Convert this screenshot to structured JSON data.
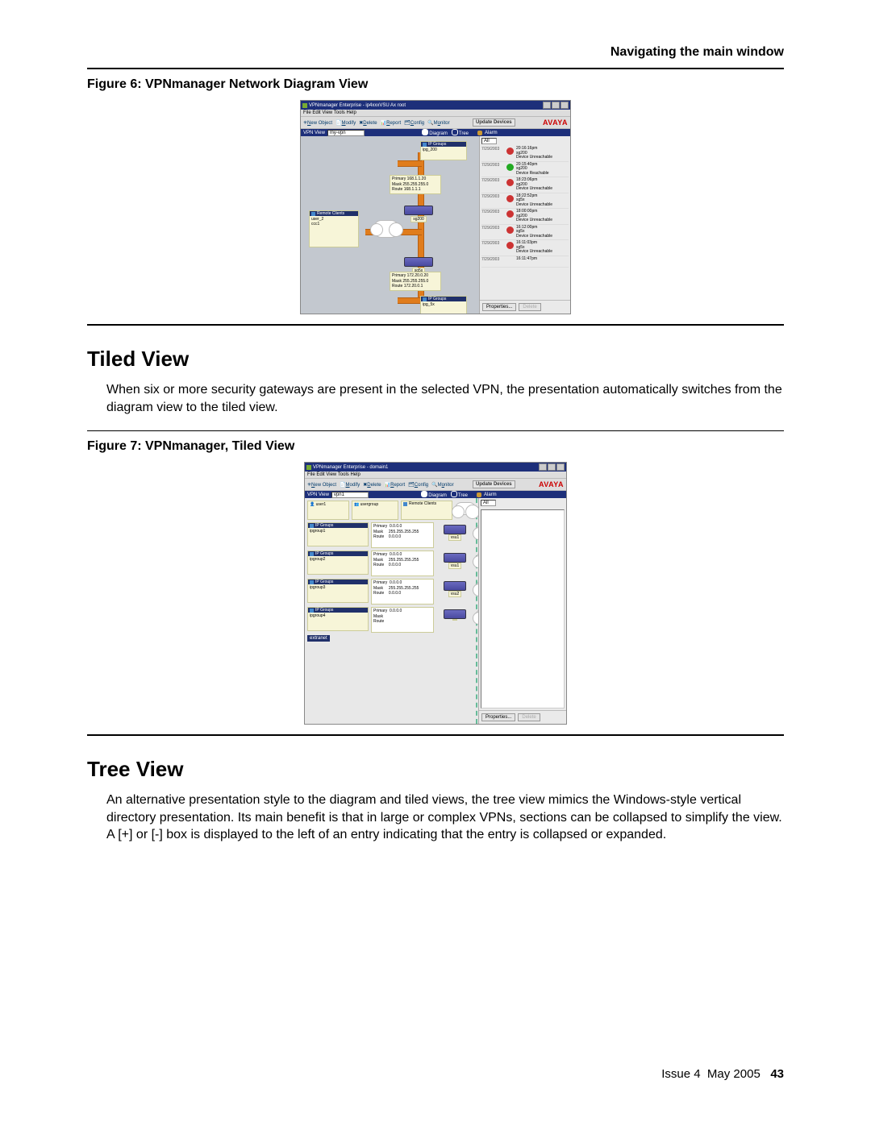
{
  "header": "Navigating the main window",
  "fig1_caption": "Figure 6: VPNmanager Network Diagram View",
  "fig2_caption": "Figure 7: VPNmanager, Tiled View",
  "tiled": {
    "heading": "Tiled View",
    "para": "When six or more security gateways are present in the selected VPN, the presentation automatically switches from the diagram view to the tiled view."
  },
  "tree": {
    "heading": "Tree View",
    "para": "An alternative presentation style to the diagram and tiled views, the tree view mimics the Windows-style vertical directory presentation. Its main benefit is that in large or complex VPNs, sections can be collapsed to simplify the view. A [+] or [-] box is displayed to the left of an entry indicating that the entry is collapsed or expanded."
  },
  "footer": {
    "issue": "Issue 4",
    "date": "May 2005",
    "page": "43"
  },
  "fig1": {
    "title": "VPNmanager Enterprise - ip4xxxVSU Ax root",
    "menu": "File  Edit  View  Tools  Help",
    "toolbar": [
      "New Object",
      "Modify",
      "Delete",
      "Report",
      "Config",
      "Monitor"
    ],
    "update": "Update Devices",
    "brand": "AVAYA",
    "vpnview_lbl": "VPN View",
    "vpnview_val": "my-vpn",
    "radio_diagram": "Diagram",
    "radio_tree": "Tree",
    "alarm_hdr": "Alarm",
    "alarm_filter": "All",
    "dev_top": {
      "label": "sg200",
      "name": "sg200",
      "det": {
        "primary": "Primary  168.1.1.20",
        "mask": "Mask     255.255.255.0",
        "route": "Route    168.1.1.1"
      }
    },
    "dev_bot": {
      "label": "sg5x",
      "name": "sg5x",
      "det": {
        "primary": "Primary  172.20.0.20",
        "mask": "Mask     255.255.255.0",
        "route": "Route    172.20.0.1"
      }
    },
    "remote": {
      "hdr": "Remote Clients",
      "items": [
        "user_2",
        "ccc1"
      ]
    },
    "ipg_top": {
      "hdr": "IP Groups",
      "item": "ipg_200"
    },
    "ipg_bot": {
      "hdr": "IP Groups",
      "item": "ipg_5x"
    },
    "props": "Properties...",
    "delete": "Delete",
    "alarms": [
      {
        "d": "7/29/2003",
        "t": "20:16:16pm",
        "n": "sg200",
        "s": "Device Unreachable",
        "c": "red"
      },
      {
        "d": "7/29/2003",
        "t": "20:15:40pm",
        "n": "sg200",
        "s": "Device Reachable",
        "c": "grn"
      },
      {
        "d": "7/29/2003",
        "t": "18:23:06pm",
        "n": "sg200",
        "s": "Device Unreachable",
        "c": "red"
      },
      {
        "d": "7/29/2003",
        "t": "18:22:52pm",
        "n": "sg5x",
        "s": "Device Unreachable",
        "c": "red"
      },
      {
        "d": "7/29/2003",
        "t": "18:00:00pm",
        "n": "sg200",
        "s": "Device Unreachable",
        "c": "red"
      },
      {
        "d": "7/29/2003",
        "t": "16:12:00pm",
        "n": "sg5x",
        "s": "Device Unreachable",
        "c": "red"
      },
      {
        "d": "7/29/2003",
        "t": "16:11:03pm",
        "n": "sg5x",
        "s": "Device Unreachable",
        "c": "red"
      },
      {
        "d": "7/29/2003",
        "t": "16:11:47pm",
        "n": "",
        "s": "",
        "c": ""
      }
    ]
  },
  "fig2": {
    "title": "VPNmanager Enterprise - domain1",
    "menu": "File  Edit  View  Tools  Help",
    "toolbar": [
      "New Object",
      "Modify",
      "Delete",
      "Report",
      "Config",
      "Monitor"
    ],
    "update": "Update Devices",
    "brand": "AVAYA",
    "vpnview_lbl": "VPN View",
    "vpnview_val": "vpn1",
    "radio_diagram": "Diagram",
    "radio_tree": "Tree",
    "alarm_hdr": "Alarm",
    "alarm_filter": "All",
    "row0": {
      "user": "user1",
      "grp": "usergroup",
      "rem": "Remote Clients"
    },
    "rows": [
      {
        "hdr": "IP Groups",
        "name": "ipgroup1",
        "primary": "0.0.0.0",
        "mask": "255.255.255.255",
        "route": "0.0.0.0",
        "dev": "vsu1"
      },
      {
        "hdr": "IP Groups",
        "name": "ipgroup2",
        "primary": "0.0.0.0",
        "mask": "255.255.255.255",
        "route": "0.0.0.0",
        "dev": "vsu1"
      },
      {
        "hdr": "IP Groups",
        "name": "ipgroup3",
        "primary": "0.0.0.0",
        "mask": "255.255.255.255",
        "route": "0.0.0.0",
        "dev": "vsu2"
      },
      {
        "hdr": "IP Groups",
        "name": "ipgroup4",
        "primary": "0.0.0.0",
        "mask": "",
        "route": "",
        "dev": ""
      }
    ],
    "extranet": "extranet",
    "props": "Properties...",
    "delete": "Delete"
  }
}
